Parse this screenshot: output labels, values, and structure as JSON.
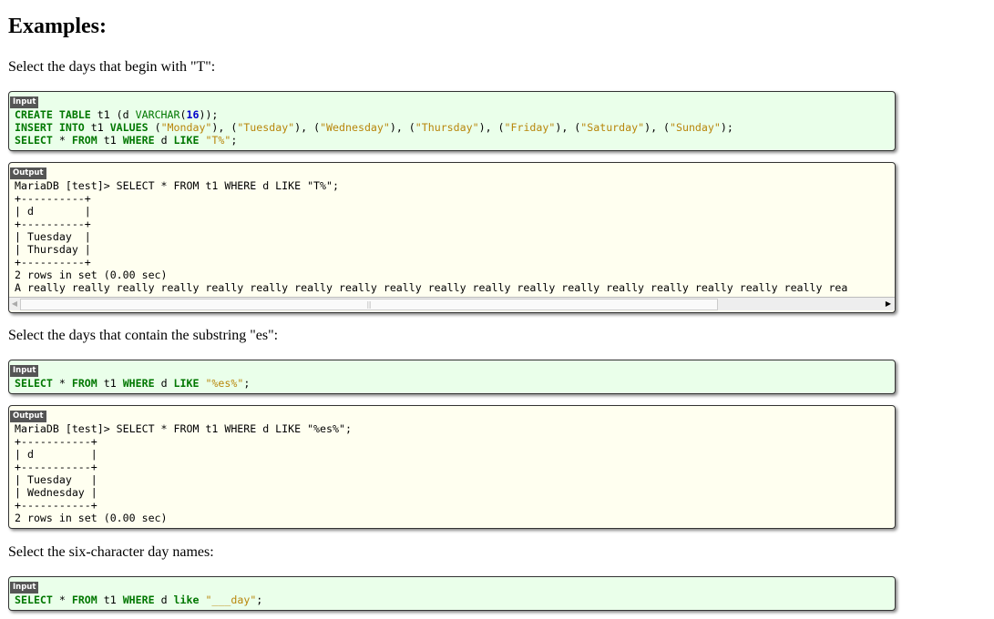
{
  "heading": "Examples:",
  "paragraphs": [
    "Select the days that begin with \"T\":",
    "Select the days that contain the substring \"es\":",
    "Select the six-character day names:"
  ],
  "labels": {
    "input": "Input",
    "output": "Output"
  },
  "input1": [
    [
      [
        "kw",
        "CREATE TABLE"
      ],
      [
        "t",
        " t1 (d "
      ],
      [
        "fn",
        "VARCHAR"
      ],
      [
        "t",
        "("
      ],
      [
        "num",
        "16"
      ],
      [
        "t",
        "));"
      ]
    ],
    [
      [
        "kw",
        "INSERT INTO"
      ],
      [
        "t",
        " t1 "
      ],
      [
        "kw",
        "VALUES"
      ],
      [
        "t",
        " ("
      ],
      [
        "str",
        "\"Monday\""
      ],
      [
        "t",
        "), ("
      ],
      [
        "str",
        "\"Tuesday\""
      ],
      [
        "t",
        "), ("
      ],
      [
        "str",
        "\"Wednesday\""
      ],
      [
        "t",
        "), ("
      ],
      [
        "str",
        "\"Thursday\""
      ],
      [
        "t",
        "), ("
      ],
      [
        "str",
        "\"Friday\""
      ],
      [
        "t",
        "), ("
      ],
      [
        "str",
        "\"Saturday\""
      ],
      [
        "t",
        "), ("
      ],
      [
        "str",
        "\"Sunday\""
      ],
      [
        "t",
        ");"
      ]
    ],
    [
      [
        "kw",
        "SELECT"
      ],
      [
        "t",
        " * "
      ],
      [
        "kw",
        "FROM"
      ],
      [
        "t",
        " t1 "
      ],
      [
        "kw",
        "WHERE"
      ],
      [
        "t",
        " d "
      ],
      [
        "kw",
        "LIKE"
      ],
      [
        "t",
        " "
      ],
      [
        "str",
        "\"T%\""
      ],
      [
        "t",
        ";"
      ]
    ]
  ],
  "output1": "MariaDB [test]> SELECT * FROM t1 WHERE d LIKE \"T%\";\n+----------+\n| d        |\n+----------+\n| Tuesday  |\n| Thursday |\n+----------+\n2 rows in set (0.00 sec)\nA really really really really really really really really really really really really really really really really really really rea",
  "input2": [
    [
      [
        "kw",
        "SELECT"
      ],
      [
        "t",
        " * "
      ],
      [
        "kw",
        "FROM"
      ],
      [
        "t",
        " t1 "
      ],
      [
        "kw",
        "WHERE"
      ],
      [
        "t",
        " d "
      ],
      [
        "kw",
        "LIKE"
      ],
      [
        "t",
        " "
      ],
      [
        "str",
        "\"%es%\""
      ],
      [
        "t",
        ";"
      ]
    ]
  ],
  "output2": "MariaDB [test]> SELECT * FROM t1 WHERE d LIKE \"%es%\";\n+-----------+\n| d         |\n+-----------+\n| Tuesday   |\n| Wednesday |\n+-----------+\n2 rows in set (0.00 sec)",
  "input3": [
    [
      [
        "kw",
        "SELECT"
      ],
      [
        "t",
        " * "
      ],
      [
        "kw",
        "FROM"
      ],
      [
        "t",
        " t1 "
      ],
      [
        "kw",
        "WHERE"
      ],
      [
        "t",
        " d "
      ],
      [
        "kw",
        "like"
      ],
      [
        "t",
        " "
      ],
      [
        "str",
        "\"___day\""
      ],
      [
        "t",
        ";"
      ]
    ]
  ]
}
